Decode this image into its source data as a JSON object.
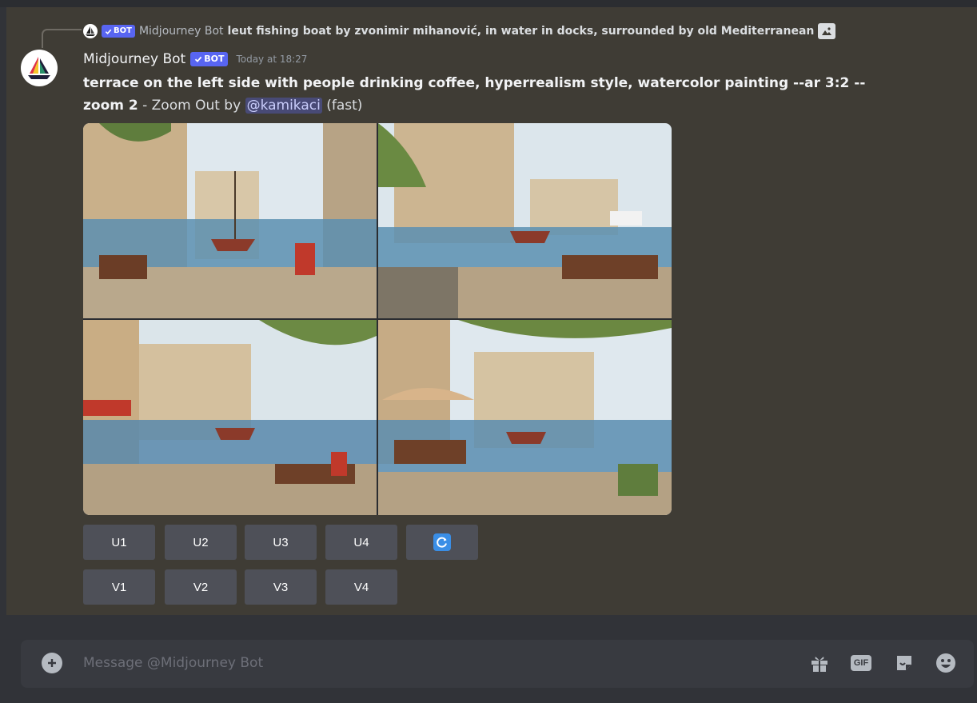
{
  "reply": {
    "username": "Midjourney Bot",
    "bot_badge": "BOT",
    "text": "leut fishing boat by zvonimir mihanović, in water in docks, surrounded by old Mediterranean",
    "attachment_icon": "image-icon"
  },
  "message": {
    "username": "Midjourney Bot",
    "bot_badge": "BOT",
    "timestamp": "Today at 18:27",
    "prompt_line1": "terrace on the left side with people drinking coffee, hyperrealism style, watercolor painting --ar 3:2 --",
    "prompt_line2": "zoom 2",
    "suffix_sep": " - Zoom Out by ",
    "mention": "@kamikaci",
    "speed": " (fast)"
  },
  "buttons": {
    "upscale": [
      "U1",
      "U2",
      "U3",
      "U4"
    ],
    "variation": [
      "V1",
      "V2",
      "V3",
      "V4"
    ],
    "reroll_icon": "refresh-icon"
  },
  "composer": {
    "placeholder": "Message @Midjourney Bot",
    "icons": [
      "gift-icon",
      "gif-icon",
      "sticker-icon",
      "emoji-icon"
    ],
    "gif_label": "GIF"
  },
  "colors": {
    "accent": "#5865f2",
    "button_bg": "#4e5058",
    "refresh_icon": "#3a8ee6",
    "message_bg": "#3f3c35",
    "background": "#313338"
  }
}
